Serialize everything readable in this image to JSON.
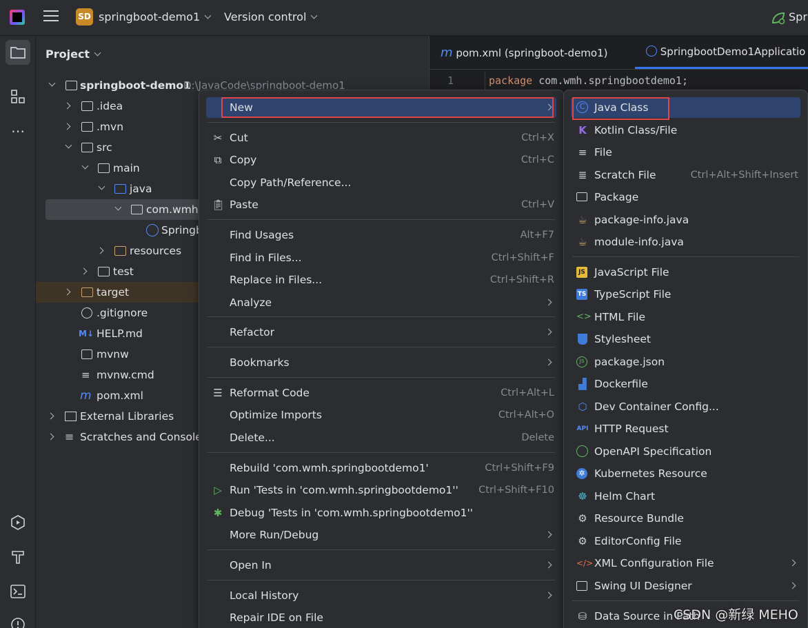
{
  "titlebar": {
    "project_badge": "SD",
    "project_name": "springboot-demo1",
    "vcs": "Version control",
    "run_label": "Spri"
  },
  "project_panel": {
    "title": "Project",
    "tree": [
      {
        "label": "springboot-demo1",
        "sub": "D:\\JavaCode\\springboot-demo1",
        "bold": true
      },
      {
        "label": ".idea"
      },
      {
        "label": ".mvn"
      },
      {
        "label": "src"
      },
      {
        "label": "main"
      },
      {
        "label": "java"
      },
      {
        "label": "com.wmh."
      },
      {
        "label": "Springb"
      },
      {
        "label": "resources"
      },
      {
        "label": "test"
      },
      {
        "label": "target"
      },
      {
        "label": ".gitignore"
      },
      {
        "label": "HELP.md"
      },
      {
        "label": "mvnw"
      },
      {
        "label": "mvnw.cmd"
      },
      {
        "label": "pom.xml"
      },
      {
        "label": "External Libraries"
      },
      {
        "label": "Scratches and Consoles"
      }
    ]
  },
  "editor": {
    "tabs": [
      {
        "label": "pom.xml (springboot-demo1)"
      },
      {
        "label": "SpringbootDemo1Applicatio"
      }
    ],
    "line_number": "1",
    "code_keyword": "package",
    "code_rest": " com.wmh.springbootdemo1;"
  },
  "context_menu": {
    "items": [
      {
        "label": "New",
        "shortcut": "",
        "submenu": true
      },
      {
        "label": "Cut",
        "shortcut": "Ctrl+X"
      },
      {
        "label": "Copy",
        "shortcut": "Ctrl+C"
      },
      {
        "label": "Copy Path/Reference...",
        "shortcut": ""
      },
      {
        "label": "Paste",
        "shortcut": "Ctrl+V"
      },
      {
        "label": "Find Usages",
        "shortcut": "Alt+F7"
      },
      {
        "label": "Find in Files...",
        "shortcut": "Ctrl+Shift+F"
      },
      {
        "label": "Replace in Files...",
        "shortcut": "Ctrl+Shift+R"
      },
      {
        "label": "Analyze",
        "shortcut": "",
        "submenu": true
      },
      {
        "label": "Refactor",
        "shortcut": "",
        "submenu": true
      },
      {
        "label": "Bookmarks",
        "shortcut": "",
        "submenu": true
      },
      {
        "label": "Reformat Code",
        "shortcut": "Ctrl+Alt+L"
      },
      {
        "label": "Optimize Imports",
        "shortcut": "Ctrl+Alt+O"
      },
      {
        "label": "Delete...",
        "shortcut": "Delete"
      },
      {
        "label": "Rebuild 'com.wmh.springbootdemo1'",
        "shortcut": "Ctrl+Shift+F9"
      },
      {
        "label": "Run 'Tests in 'com.wmh.springbootdemo1''",
        "shortcut": "Ctrl+Shift+F10"
      },
      {
        "label": "Debug 'Tests in 'com.wmh.springbootdemo1''",
        "shortcut": ""
      },
      {
        "label": "More Run/Debug",
        "shortcut": "",
        "submenu": true
      },
      {
        "label": "Open In",
        "shortcut": "",
        "submenu": true
      },
      {
        "label": "Local History",
        "shortcut": "",
        "submenu": true
      },
      {
        "label": "Repair IDE on File",
        "shortcut": ""
      }
    ]
  },
  "new_submenu": {
    "items": [
      {
        "label": "Java Class"
      },
      {
        "label": "Kotlin Class/File"
      },
      {
        "label": "File"
      },
      {
        "label": "Scratch File",
        "shortcut": "Ctrl+Alt+Shift+Insert"
      },
      {
        "label": "Package"
      },
      {
        "label": "package-info.java"
      },
      {
        "label": "module-info.java"
      },
      {
        "label": "JavaScript File"
      },
      {
        "label": "TypeScript File"
      },
      {
        "label": "HTML File"
      },
      {
        "label": "Stylesheet"
      },
      {
        "label": "package.json"
      },
      {
        "label": "Dockerfile"
      },
      {
        "label": "Dev Container Config..."
      },
      {
        "label": "HTTP Request"
      },
      {
        "label": "OpenAPI Specification"
      },
      {
        "label": "Kubernetes Resource"
      },
      {
        "label": "Helm Chart"
      },
      {
        "label": "Resource Bundle"
      },
      {
        "label": "EditorConfig File"
      },
      {
        "label": "XML Configuration File",
        "submenu": true
      },
      {
        "label": "Swing UI Designer",
        "submenu": true
      },
      {
        "label": "Data Source in Path"
      }
    ]
  },
  "icons": {
    "js_badge": "JS",
    "ts_badge": "TS",
    "api_badge": "API",
    "md_badge": "M↓"
  },
  "watermark": "CSDN @新绿 MEHO"
}
